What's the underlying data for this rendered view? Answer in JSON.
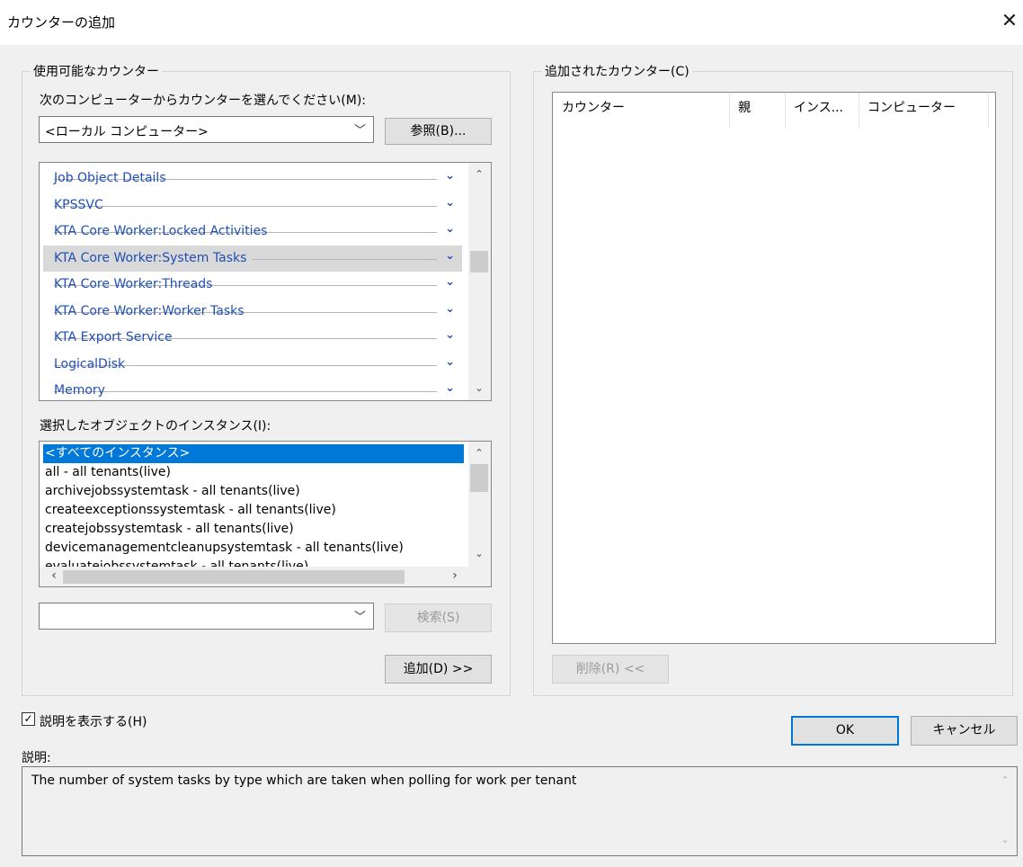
{
  "window": {
    "title": "カウンターの追加",
    "close_glyph": "✕"
  },
  "available": {
    "group_label": "使用可能なカウンター",
    "computer_label": "次のコンピューターからカウンターを選んでください(M):",
    "computer_value": "<ローカル コンピューター>",
    "browse_button": "参照(B)...",
    "objects": [
      "Job Object Details",
      "KPSSVC",
      "KTA Core Worker:Locked Activities",
      "KTA Core Worker:System Tasks",
      "KTA Core Worker:Threads",
      "KTA Core Worker:Worker Tasks",
      "KTA Export Service",
      "LogicalDisk",
      "Memory"
    ],
    "selected_object": "KTA Core Worker:System Tasks",
    "instances_label": "選択したオブジェクトのインスタンス(I):",
    "instances": [
      "<すべてのインスタンス>",
      "all - all tenants(live)",
      "archivejobssystemtask - all tenants(live)",
      "createexceptionssystemtask - all tenants(live)",
      "createjobssystemtask - all tenants(live)",
      "devicemanagementcleanupsystemtask - all tenants(live)",
      "evaluatejobssystemtask - all tenants(live)"
    ],
    "selected_instance": "<すべてのインスタンス>",
    "search_value": "",
    "search_button": "検索(S)",
    "add_button": "追加(D) >>"
  },
  "added": {
    "group_label": "追加されたカウンター(C)",
    "columns": [
      "カウンター",
      "親",
      "インス...",
      "コンピューター"
    ],
    "rows": [],
    "remove_button": "削除(R) <<"
  },
  "show_description": {
    "label": "説明を表示する(H)",
    "checked": true
  },
  "ok_button": "OK",
  "cancel_button": "キャンセル",
  "description": {
    "label": "説明:",
    "text": "The number of system tasks by type which are taken when polling for work per tenant"
  },
  "colors": {
    "link_blue": "#1f4fb4",
    "selection_blue": "#0078d7",
    "selection_gray": "#d9d9d9"
  }
}
